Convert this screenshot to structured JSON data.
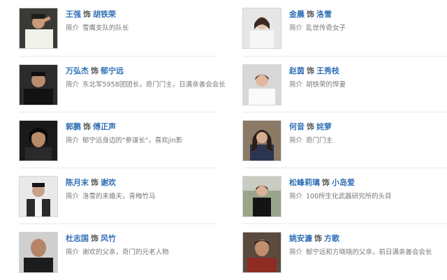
{
  "label_shi": "饰",
  "label_intro": "简介",
  "cast_left": [
    {
      "actor": "王强",
      "role": "胡铁荣",
      "intro": "雪鹰支队的队长",
      "photo_icon": "man-navy-uniform-saluting-photo"
    },
    {
      "actor": "万弘杰",
      "role": "郁宁远",
      "intro": "东北军5958团团长，奇门门主，日满亲善会会长",
      "photo_icon": "man-dark-suit-photo"
    },
    {
      "actor": "郭鹏",
      "role": "傅正声",
      "intro": "郁宁远身边的\"参谋长\"，喜欢jin影",
      "photo_icon": "man-long-hair-portrait-photo"
    },
    {
      "actor": "陈月末",
      "role": "谢欢",
      "intro": "洛雪的未婚夫，青梅竹马",
      "photo_icon": "young-man-vest-photo"
    },
    {
      "actor": "杜志国",
      "role": "风竹",
      "intro": "谢欢的父亲，奇门的元老人物",
      "photo_icon": "bald-man-portrait-photo"
    }
  ],
  "cast_right": [
    {
      "actor": "金晨",
      "role": "洛雪",
      "intro": "乱世传奇女子",
      "photo_icon": "woman-white-dress-photo"
    },
    {
      "actor": "赵茵",
      "role": "王秀枝",
      "intro": "胡铁荣的悍妻",
      "photo_icon": "woman-white-blouse-photo"
    },
    {
      "actor": "何音",
      "role": "姹萝",
      "intro": "奇门门主",
      "photo_icon": "woman-long-hair-photo"
    },
    {
      "actor": "松峰莉璃",
      "role": "小岛爱",
      "intro": "100所生化武器研究所的头目",
      "photo_icon": "woman-black-dress-outdoor-photo"
    },
    {
      "actor": "姚安濂",
      "role": "方歌",
      "intro": "郁宁远和方晓晓的父亲，前日满亲善会会长",
      "photo_icon": "man-red-shirt-photo"
    }
  ],
  "colors": {
    "link_blue": "#2f6fb6",
    "text_gray": "#777777",
    "divider": "#e8e8e8"
  }
}
